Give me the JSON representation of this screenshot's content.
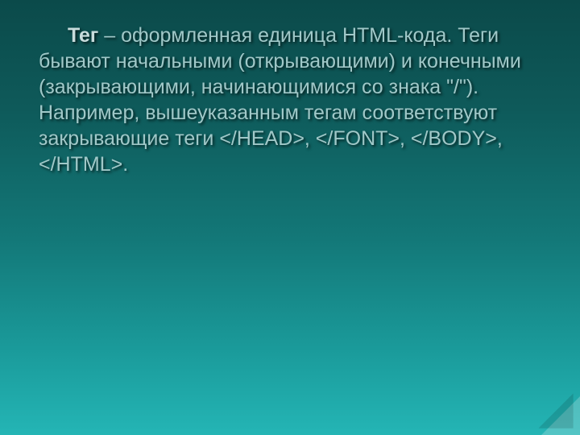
{
  "slide": {
    "term": "Тег",
    "body": " – оформленная единица HTML-кода. Теги бывают начальными (открывающими) и конечными (закрывающими, начинающимися со знака \"/\"). Например, вышеуказанным тегам соответствуют закрывающие теги </HEAD>, </FONT>, </BODY>, </HTML>."
  }
}
